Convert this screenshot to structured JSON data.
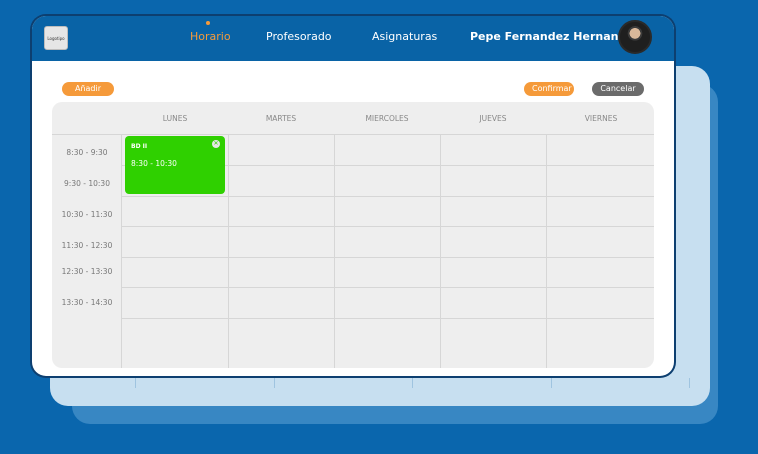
{
  "logo": {
    "text": "Logotipo"
  },
  "nav": {
    "horario": "Horario",
    "profesorado": "Profesorado",
    "asignaturas": "Asignaturas"
  },
  "user": {
    "name": "Pepe Fernandez Hernandez"
  },
  "toolbar": {
    "add_label": "Añadir",
    "confirm_label": "Confirmar",
    "cancel_label": "Cancelar"
  },
  "calendar": {
    "days": [
      "LUNES",
      "MARTES",
      "MIERCOLES",
      "JUEVES",
      "VIERNES"
    ],
    "times": [
      "8:30 - 9:30",
      "9:30 - 10:30",
      "10:30 - 11:30",
      "11:30 - 12:30",
      "12:30 - 13:30",
      "13:30 - 14:30"
    ],
    "event": {
      "title": "BD II",
      "time": "8:30 - 10:30",
      "color": "#2fd000"
    }
  },
  "colors": {
    "brand_blue": "#0963a6",
    "accent_orange": "#f59a3a",
    "neutral_gray": "#6b6b6b"
  }
}
